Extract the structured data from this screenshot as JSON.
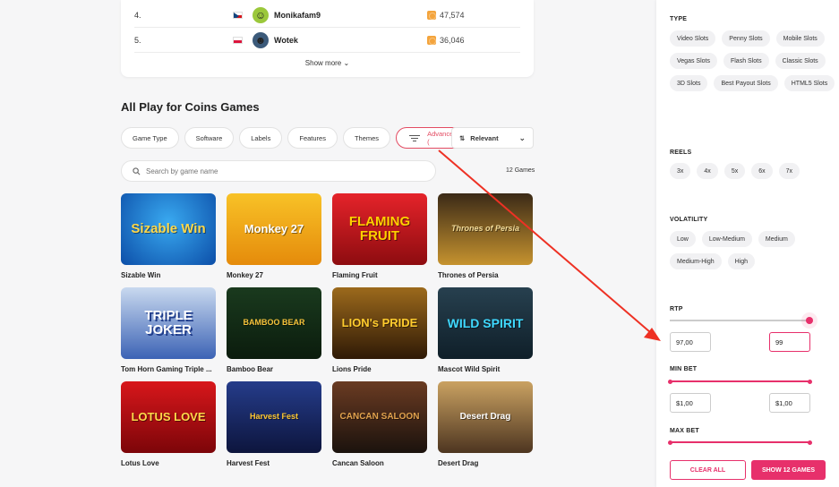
{
  "leaderboard": {
    "rows": [
      {
        "rank": "4.",
        "name": "Monikafam9",
        "amount": "47,574",
        "flag": "cz"
      },
      {
        "rank": "5.",
        "name": "Wotek",
        "amount": "36,046",
        "flag": "pl"
      }
    ],
    "show_more": "Show more"
  },
  "section_title": "All Play for Coins Games",
  "filters": {
    "chips": [
      "Game Type",
      "Software",
      "Labels",
      "Features",
      "Themes"
    ],
    "advanced": "Advanced (",
    "sort": "Relevant"
  },
  "search": {
    "placeholder": "Search by game name"
  },
  "games_count": "12 Games",
  "games": [
    {
      "name": "Sizable Win",
      "art": "Sizable Win"
    },
    {
      "name": "Monkey 27",
      "art": "Monkey 27"
    },
    {
      "name": "Flaming Fruit",
      "art": "FLAMING FRUIT"
    },
    {
      "name": "Thrones of Persia",
      "art": "Thrones of Persia"
    },
    {
      "name": "Tom Horn Gaming Triple ...",
      "art": "TRIPLE JOKER"
    },
    {
      "name": "Bamboo Bear",
      "art": "BAMBOO BEAR"
    },
    {
      "name": "Lions Pride",
      "art": "LION's PRIDE"
    },
    {
      "name": "Mascot Wild Spirit",
      "art": "WILD SPIRIT"
    },
    {
      "name": "Lotus Love",
      "art": "LOTUS LOVE"
    },
    {
      "name": "Harvest Fest",
      "art": "Harvest Fest"
    },
    {
      "name": "Cancan Saloon",
      "art": "CANCAN SALOON"
    },
    {
      "name": "Desert Drag",
      "art": "Desert Drag"
    }
  ],
  "sidebar": {
    "type_heading": "TYPE",
    "types": [
      "Video Slots",
      "Penny Slots",
      "Mobile Slots",
      "Vegas Slots",
      "Flash Slots",
      "Classic Slots",
      "3D Slots",
      "Best Payout Slots",
      "HTML5 Slots"
    ],
    "reels_heading": "REELS",
    "reels": [
      "3x",
      "4x",
      "5x",
      "6x",
      "7x"
    ],
    "volatility_heading": "VOLATILITY",
    "volatility": [
      "Low",
      "Low-Medium",
      "Medium",
      "Medium-High",
      "High"
    ],
    "rtp_heading": "RTP",
    "rtp_min": "97,00",
    "rtp_max": "99",
    "min_bet_heading": "MIN BET",
    "min_bet_min": "$1,00",
    "min_bet_max": "$1,00",
    "max_bet_heading": "MAX BET",
    "clear_all": "CLEAR ALL",
    "show_games": "SHOW 12 GAMES"
  },
  "colors": {
    "accent": "#e7306b",
    "annotation_arrow": "#ee3124"
  }
}
